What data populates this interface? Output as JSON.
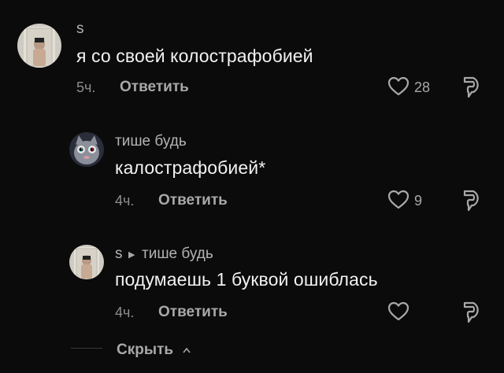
{
  "comments": [
    {
      "username": "s",
      "text": "я со своей колострафобией",
      "time": "5ч.",
      "reply_label": "Ответить",
      "likes": "28"
    },
    {
      "username": "тише будь",
      "text": "калострафобией*",
      "time": "4ч.",
      "reply_label": "Ответить",
      "likes": "9"
    },
    {
      "username": "s",
      "reply_to": "тише будь",
      "text": "подумаешь 1 буквой ошиблась",
      "time": "4ч.",
      "reply_label": "Ответить",
      "likes": ""
    }
  ],
  "hide_label": "Скрыть",
  "colors": {
    "background": "#0b0b0b",
    "text": "#f2f2f2",
    "muted": "#a8a8a8"
  }
}
